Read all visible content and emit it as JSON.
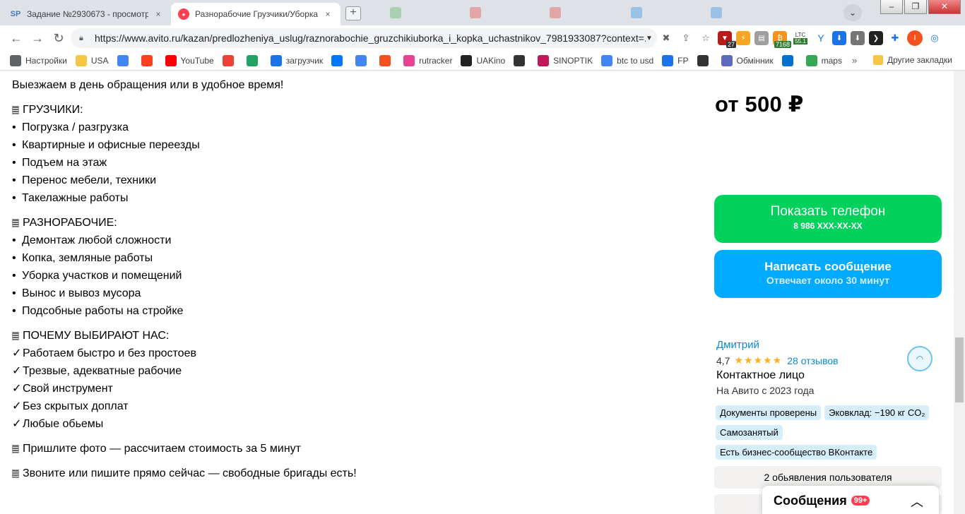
{
  "browser": {
    "tabs": [
      {
        "favicon": "SP",
        "title": "Задание №2930673 - просмотр з",
        "close": "×",
        "active": false
      },
      {
        "favicon": "●",
        "title": "Разнорабочие Грузчики/Уборка",
        "close": "×",
        "active": true
      }
    ],
    "window_buttons": {
      "minimize": "–",
      "maximize": "❐",
      "close": "✕"
    },
    "profile_dropdown": "⌄",
    "url": "https://www.avito.ru/kazan/predlozheniya_uslug/raznorabochie_gruzchikiuborka_i_kopka_uchastnikov_7981933087?context=...",
    "extensions": {
      "ext1_badge": "27",
      "ltc_label": "LTC",
      "ltc_value": "55.1",
      "btc_value": "7168",
      "avatar_letter": "I"
    },
    "bookmarks": [
      {
        "label": "Настройки",
        "icon": "gear-icon",
        "color": "#5f6368"
      },
      {
        "label": "USA",
        "icon": "folder-icon",
        "color": "#f6c744"
      },
      {
        "label": "",
        "icon": "google-icon",
        "color": "#4285f4"
      },
      {
        "label": "",
        "icon": "yandex-icon",
        "color": "#fc3f1d"
      },
      {
        "label": "YouTube",
        "icon": "youtube-icon",
        "color": "#ff0000"
      },
      {
        "label": "",
        "icon": "gmail-icon",
        "color": "#ea4335"
      },
      {
        "label": "",
        "icon": "drive-icon",
        "color": "#1fa463"
      },
      {
        "label": "загрузчик",
        "icon": "loader-icon",
        "color": "#1a73e8"
      },
      {
        "label": "",
        "icon": "vk-icon",
        "color": "#0077ff"
      },
      {
        "label": "",
        "icon": "translate-icon",
        "color": "#4285f4"
      },
      {
        "label": "",
        "icon": "f-icon",
        "color": "#f4511e"
      },
      {
        "label": "rutracker",
        "icon": "rutracker-icon",
        "color": "#e84393"
      },
      {
        "label": "UAKino",
        "icon": "uakino-icon",
        "color": "#222222"
      },
      {
        "label": "",
        "icon": "chess-icon",
        "color": "#333333"
      },
      {
        "label": "SINOPTIK",
        "icon": "sinoptik-icon",
        "color": "#c2185b"
      },
      {
        "label": "btc to usd",
        "icon": "google-icon",
        "color": "#4285f4"
      },
      {
        "label": "FP",
        "icon": "fp-icon",
        "color": "#1a73e8"
      },
      {
        "label": "",
        "icon": "bc-icon",
        "color": "#333333"
      },
      {
        "label": "Обмінник",
        "icon": "exchange-icon",
        "color": "#5c6bc0"
      },
      {
        "label": "",
        "icon": "walmart-icon",
        "color": "#0071ce"
      },
      {
        "label": "maps",
        "icon": "maps-icon",
        "color": "#34a853"
      }
    ],
    "bookmarks_more": "»",
    "other_bookmarks": "Другие закладки"
  },
  "description": {
    "intro": "Выезжаем в день обращения или в удобное время!",
    "sections": [
      {
        "heading": "ГРУЗЧИКИ:",
        "marker": "•",
        "items": [
          "Погрузка / разгрузка",
          "Квартирные и офисные переезды",
          "Подъем на этаж",
          "Перенос мебели, техники",
          "Такелажные работы"
        ]
      },
      {
        "heading": "РАЗНОРАБОЧИЕ:",
        "marker": "•",
        "items": [
          "Демонтаж любой сложности",
          "Копка, земляные работы",
          "Уборка участков и помещений",
          "Вынос и вывоз мусора",
          "Подсобные работы на стройке"
        ]
      },
      {
        "heading": "ПОЧЕМУ ВЫБИРАЮТ НАС:",
        "marker": "✓",
        "items": [
          "Работаем быстро и без простоев",
          "Трезвые, адекватные рабочие",
          "Свой инструмент",
          "Без скрытых доплат",
          "Любые обьемы"
        ]
      }
    ],
    "photo_line": "Пришлите фото — рассчитаем стоимость за 5 минут",
    "call_line": "Звоните или пишите прямо сейчас — свободные бригады есть!"
  },
  "sidebar": {
    "price": "от 500 ₽",
    "phone_button": {
      "label": "Показать телефон",
      "sub": "8 986 XXX-XX-XX"
    },
    "message_button": {
      "label": "Написать сообщение",
      "sub": "Отвечает около 30 минут"
    },
    "seller": {
      "name": "Дмитрий",
      "rating": "4,7",
      "stars": "★★★★★",
      "reviews": "28 отзывов",
      "role": "Контактное лицо",
      "since": "На Авито с 2023 года"
    },
    "chips": [
      "Документы проверены",
      "Эковклад: −190 кг CO₂",
      "Самозанятый",
      "Есть бизнес-сообщество ВКонтакте"
    ],
    "other_ads": "2 обьявления пользователя"
  },
  "messenger": {
    "title": "Сообщения",
    "badge": "99+",
    "chevron": "︿"
  },
  "colors": {
    "green": "#02d15c",
    "blue": "#00aaff",
    "link": "#0a8ad6",
    "star": "#ffb021",
    "badge": "#ff4053"
  }
}
